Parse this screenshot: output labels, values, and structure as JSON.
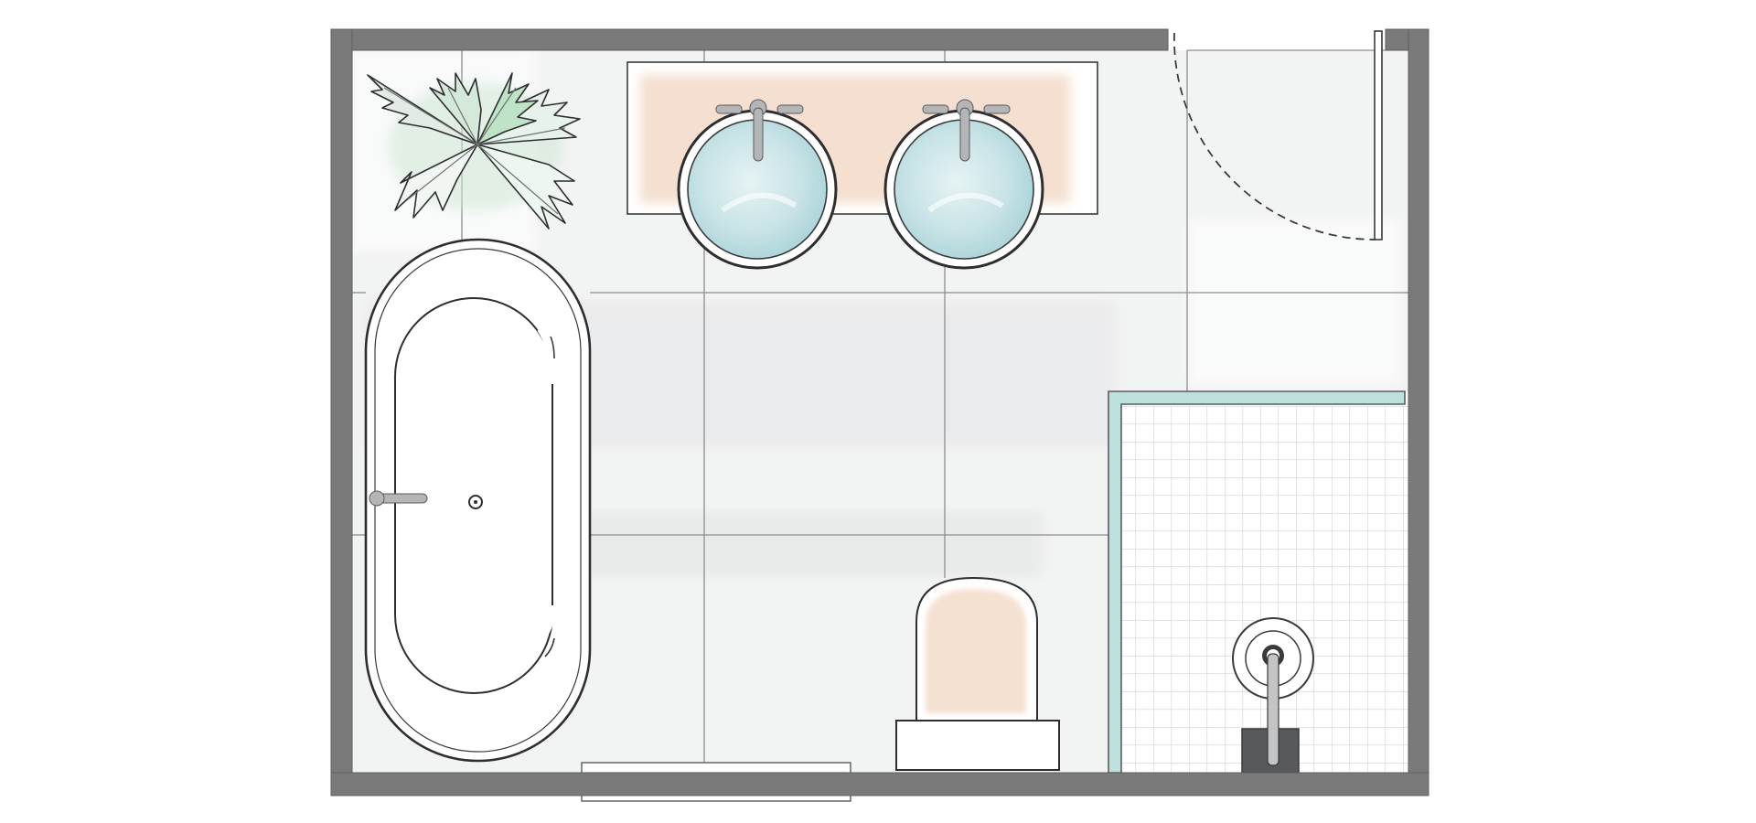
{
  "title": "",
  "colors": {
    "wall": "#7a7a7b",
    "wall_edge": "#5f5f60",
    "floor": "#f2f3f3",
    "floor_wash": "#e9eaeb",
    "grid_line": "#8c8d8f",
    "line": "#3a3a3c",
    "fixture": "#ffffff",
    "water": "#cfe6e8",
    "water_deep": "#a9d3d8",
    "wood": "#f3dccb",
    "chrome": "#a9abad",
    "plant_light": "#bfe3c7",
    "plant_mid": "#9fcfa8",
    "plant_gray": "#b9bebb",
    "shower_tile": "#dcdde0",
    "glass": "#bfe1dd"
  },
  "fixtures": [
    {
      "id": "bathtub",
      "icon": "bathtub-icon"
    },
    {
      "id": "vanity-counter",
      "icon": "vanity-icon"
    },
    {
      "id": "sink-left",
      "icon": "sink-icon"
    },
    {
      "id": "sink-right",
      "icon": "sink-icon"
    },
    {
      "id": "toilet",
      "icon": "toilet-icon"
    },
    {
      "id": "shower",
      "icon": "shower-icon"
    },
    {
      "id": "door-swing",
      "icon": "door-icon"
    },
    {
      "id": "plant",
      "icon": "plant-icon"
    },
    {
      "id": "bath-mat",
      "icon": "bath-mat-icon"
    }
  ]
}
